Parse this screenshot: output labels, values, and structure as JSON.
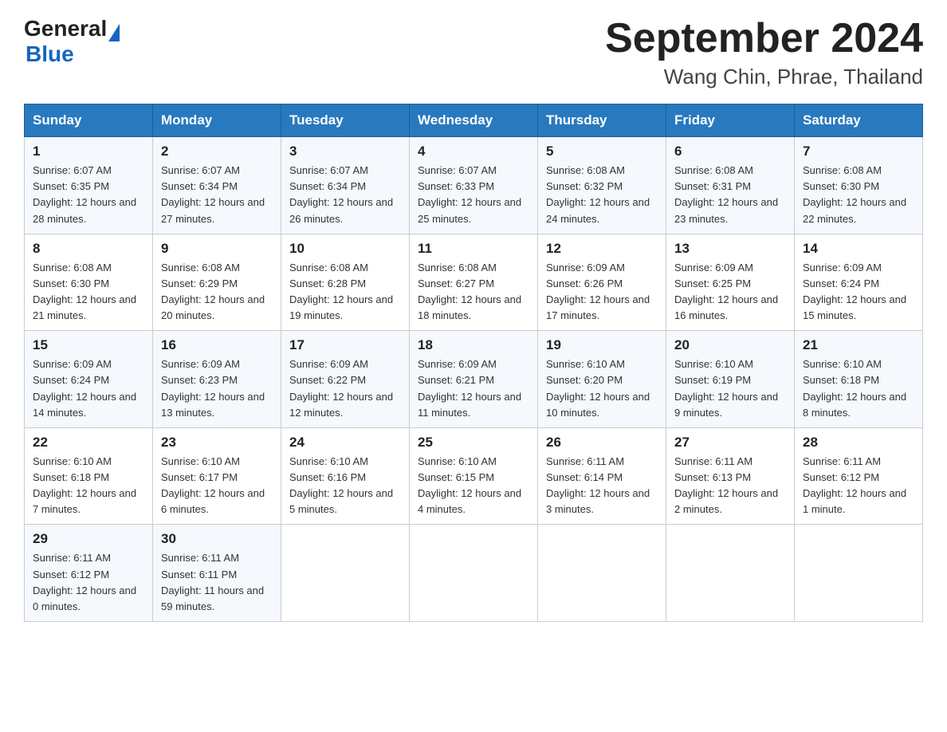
{
  "header": {
    "logo_text1": "General",
    "logo_text2": "Blue",
    "title": "September 2024",
    "subtitle": "Wang Chin, Phrae, Thailand"
  },
  "weekdays": [
    "Sunday",
    "Monday",
    "Tuesday",
    "Wednesday",
    "Thursday",
    "Friday",
    "Saturday"
  ],
  "weeks": [
    [
      {
        "day": "1",
        "sunrise": "6:07 AM",
        "sunset": "6:35 PM",
        "daylight": "12 hours and 28 minutes."
      },
      {
        "day": "2",
        "sunrise": "6:07 AM",
        "sunset": "6:34 PM",
        "daylight": "12 hours and 27 minutes."
      },
      {
        "day": "3",
        "sunrise": "6:07 AM",
        "sunset": "6:34 PM",
        "daylight": "12 hours and 26 minutes."
      },
      {
        "day": "4",
        "sunrise": "6:07 AM",
        "sunset": "6:33 PM",
        "daylight": "12 hours and 25 minutes."
      },
      {
        "day": "5",
        "sunrise": "6:08 AM",
        "sunset": "6:32 PM",
        "daylight": "12 hours and 24 minutes."
      },
      {
        "day": "6",
        "sunrise": "6:08 AM",
        "sunset": "6:31 PM",
        "daylight": "12 hours and 23 minutes."
      },
      {
        "day": "7",
        "sunrise": "6:08 AM",
        "sunset": "6:30 PM",
        "daylight": "12 hours and 22 minutes."
      }
    ],
    [
      {
        "day": "8",
        "sunrise": "6:08 AM",
        "sunset": "6:30 PM",
        "daylight": "12 hours and 21 minutes."
      },
      {
        "day": "9",
        "sunrise": "6:08 AM",
        "sunset": "6:29 PM",
        "daylight": "12 hours and 20 minutes."
      },
      {
        "day": "10",
        "sunrise": "6:08 AM",
        "sunset": "6:28 PM",
        "daylight": "12 hours and 19 minutes."
      },
      {
        "day": "11",
        "sunrise": "6:08 AM",
        "sunset": "6:27 PM",
        "daylight": "12 hours and 18 minutes."
      },
      {
        "day": "12",
        "sunrise": "6:09 AM",
        "sunset": "6:26 PM",
        "daylight": "12 hours and 17 minutes."
      },
      {
        "day": "13",
        "sunrise": "6:09 AM",
        "sunset": "6:25 PM",
        "daylight": "12 hours and 16 minutes."
      },
      {
        "day": "14",
        "sunrise": "6:09 AM",
        "sunset": "6:24 PM",
        "daylight": "12 hours and 15 minutes."
      }
    ],
    [
      {
        "day": "15",
        "sunrise": "6:09 AM",
        "sunset": "6:24 PM",
        "daylight": "12 hours and 14 minutes."
      },
      {
        "day": "16",
        "sunrise": "6:09 AM",
        "sunset": "6:23 PM",
        "daylight": "12 hours and 13 minutes."
      },
      {
        "day": "17",
        "sunrise": "6:09 AM",
        "sunset": "6:22 PM",
        "daylight": "12 hours and 12 minutes."
      },
      {
        "day": "18",
        "sunrise": "6:09 AM",
        "sunset": "6:21 PM",
        "daylight": "12 hours and 11 minutes."
      },
      {
        "day": "19",
        "sunrise": "6:10 AM",
        "sunset": "6:20 PM",
        "daylight": "12 hours and 10 minutes."
      },
      {
        "day": "20",
        "sunrise": "6:10 AM",
        "sunset": "6:19 PM",
        "daylight": "12 hours and 9 minutes."
      },
      {
        "day": "21",
        "sunrise": "6:10 AM",
        "sunset": "6:18 PM",
        "daylight": "12 hours and 8 minutes."
      }
    ],
    [
      {
        "day": "22",
        "sunrise": "6:10 AM",
        "sunset": "6:18 PM",
        "daylight": "12 hours and 7 minutes."
      },
      {
        "day": "23",
        "sunrise": "6:10 AM",
        "sunset": "6:17 PM",
        "daylight": "12 hours and 6 minutes."
      },
      {
        "day": "24",
        "sunrise": "6:10 AM",
        "sunset": "6:16 PM",
        "daylight": "12 hours and 5 minutes."
      },
      {
        "day": "25",
        "sunrise": "6:10 AM",
        "sunset": "6:15 PM",
        "daylight": "12 hours and 4 minutes."
      },
      {
        "day": "26",
        "sunrise": "6:11 AM",
        "sunset": "6:14 PM",
        "daylight": "12 hours and 3 minutes."
      },
      {
        "day": "27",
        "sunrise": "6:11 AM",
        "sunset": "6:13 PM",
        "daylight": "12 hours and 2 minutes."
      },
      {
        "day": "28",
        "sunrise": "6:11 AM",
        "sunset": "6:12 PM",
        "daylight": "12 hours and 1 minute."
      }
    ],
    [
      {
        "day": "29",
        "sunrise": "6:11 AM",
        "sunset": "6:12 PM",
        "daylight": "12 hours and 0 minutes."
      },
      {
        "day": "30",
        "sunrise": "6:11 AM",
        "sunset": "6:11 PM",
        "daylight": "11 hours and 59 minutes."
      },
      null,
      null,
      null,
      null,
      null
    ]
  ]
}
